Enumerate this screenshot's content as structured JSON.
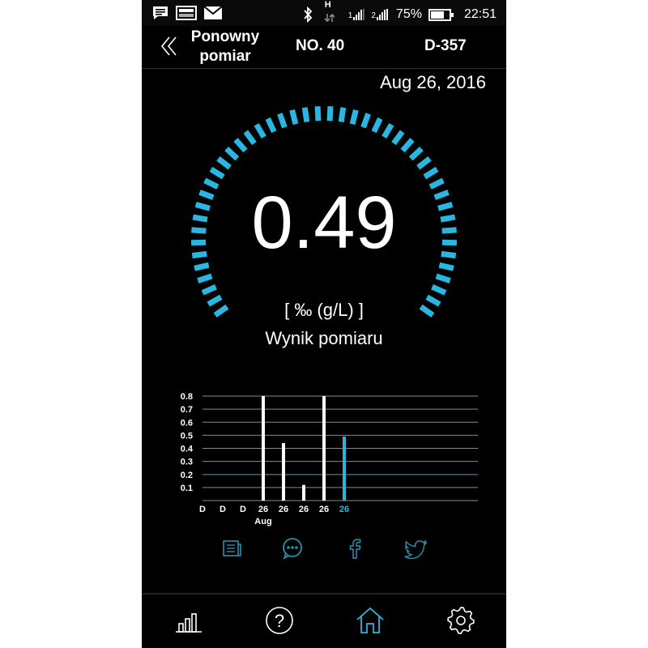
{
  "status_bar": {
    "battery_percent": "75%",
    "battery_level": 0.75,
    "time": "22:51",
    "network_type": "H",
    "sim1_label": "1",
    "sim2_label": "2",
    "icons": [
      "message-icon",
      "image-icon",
      "mail-icon",
      "bluetooth-icon",
      "data-arrows-icon",
      "signal-sim1-icon",
      "signal-sim2-icon",
      "battery-icon"
    ]
  },
  "header": {
    "back_icon": "double-chevron-left-icon",
    "title_line1": "Ponowny",
    "title_line2": "pomiar",
    "number": "NO. 40",
    "device": "D-357"
  },
  "date": "Aug 26, 2016",
  "result": {
    "value": "0.49",
    "unit": "[ ‰ (g/L) ]",
    "label": "Wynik pomiaru"
  },
  "colors": {
    "background": "#000000",
    "accent": "#29b6e0",
    "text": "#ffffff",
    "grid": "#8a8a8a",
    "threshold_line": "#1e6f8a"
  },
  "chart_data": {
    "type": "bar",
    "categories": [
      "D",
      "D",
      "D",
      "26",
      "26",
      "26",
      "26",
      "26"
    ],
    "values": [
      0,
      0,
      0,
      0.8,
      0.44,
      0.12,
      0.8,
      0.49
    ],
    "highlight_index": 7,
    "month_label": "Aug",
    "y_ticks": [
      "0.1",
      "0.2",
      "0.3",
      "0.4",
      "0.5",
      "0.6",
      "0.7",
      "0.8"
    ],
    "ylim": [
      0,
      0.8
    ],
    "threshold": 0.2,
    "grid": true
  },
  "share": {
    "icons": [
      "notes-icon",
      "message-bubble-icon",
      "facebook-icon",
      "twitter-icon"
    ]
  },
  "bottom_nav": {
    "icons": [
      "stats-icon",
      "help-icon",
      "home-icon",
      "settings-icon"
    ],
    "active": "home-icon",
    "help_glyph": "?"
  }
}
